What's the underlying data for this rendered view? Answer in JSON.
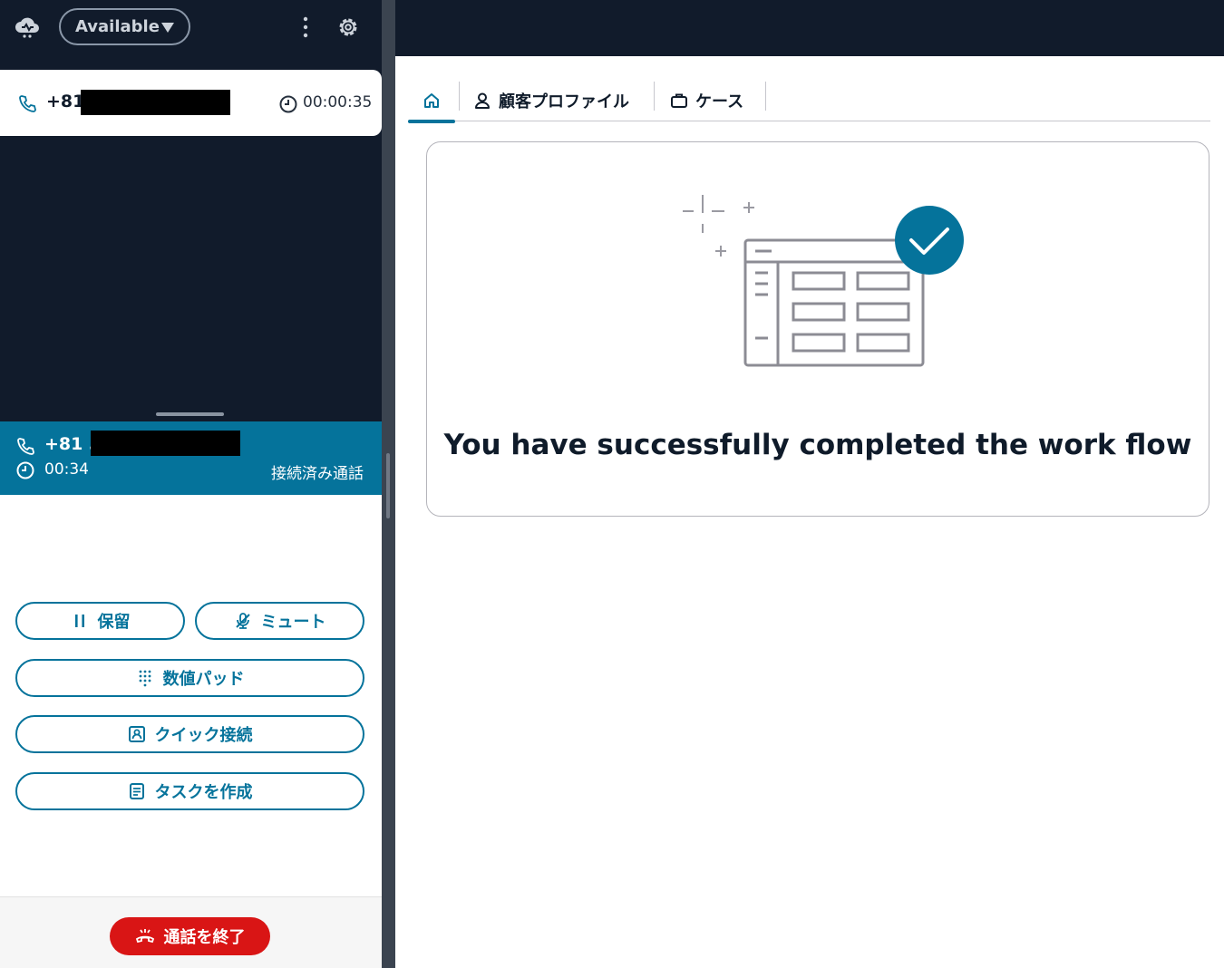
{
  "status": {
    "label": "Available"
  },
  "incoming_call": {
    "number_prefix": "+81",
    "timer": "00:00:35"
  },
  "active_call": {
    "number_prefix": "+81 5",
    "timer": "00:34",
    "state": "接続済み通話"
  },
  "controls": {
    "hold": "保留",
    "mute": "ミュート",
    "keypad": "数値パッド",
    "quick_connect": "クイック接続",
    "create_task": "タスクを作成",
    "end_call": "通話を終了"
  },
  "tabs": {
    "customer_profile": "顧客プロファイル",
    "cases": "ケース"
  },
  "workflow": {
    "message": "You have successfully completed the work flow"
  },
  "colors": {
    "accent": "#05739b",
    "danger": "#d91515",
    "navy": "#111b2b"
  }
}
